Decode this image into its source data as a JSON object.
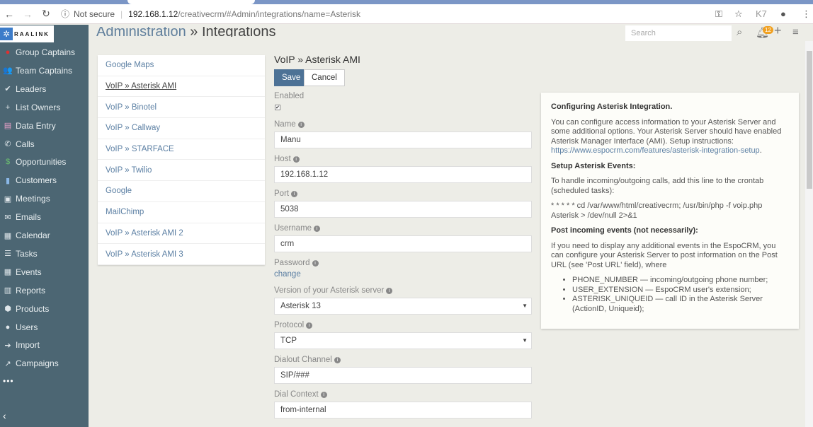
{
  "browser": {
    "not_secure": "Not secure",
    "url_host": "192.168.1.12",
    "url_path": "/creativecrm/#Admin/integrations/name=Asterisk"
  },
  "logo": "RAALINK",
  "sidebar": {
    "items": [
      {
        "label": "Group Captains",
        "icon": "●",
        "color": "#e03030"
      },
      {
        "label": "Team Captains",
        "icon": "👥",
        "color": "#dfe6ea"
      },
      {
        "label": "Leaders",
        "icon": "✔",
        "color": "#dfe6ea"
      },
      {
        "label": "List Owners",
        "icon": "+",
        "color": "#dfe6ea"
      },
      {
        "label": "Data Entry",
        "icon": "▤",
        "color": "#e8a0c8"
      },
      {
        "label": "Calls",
        "icon": "✆",
        "color": "#dfe6ea"
      },
      {
        "label": "Opportunities",
        "icon": "$",
        "color": "#6cc070"
      },
      {
        "label": "Customers",
        "icon": "▮",
        "color": "#8ab8e8"
      },
      {
        "label": "Meetings",
        "icon": "▣",
        "color": "#dfe6ea"
      },
      {
        "label": "Emails",
        "icon": "✉",
        "color": "#dfe6ea"
      },
      {
        "label": "Calendar",
        "icon": "▦",
        "color": "#dfe6ea"
      },
      {
        "label": "Tasks",
        "icon": "☰",
        "color": "#dfe6ea"
      },
      {
        "label": "Events",
        "icon": "▦",
        "color": "#dfe6ea"
      },
      {
        "label": "Reports",
        "icon": "▥",
        "color": "#dfe6ea"
      },
      {
        "label": "Products",
        "icon": "⬢",
        "color": "#dfe6ea"
      },
      {
        "label": "Users",
        "icon": "●",
        "color": "#dfe6ea"
      },
      {
        "label": "Import",
        "icon": "➔",
        "color": "#dfe6ea"
      },
      {
        "label": "Campaigns",
        "icon": "↗",
        "color": "#dfe6ea"
      }
    ],
    "more": "•••",
    "collapse": "‹"
  },
  "header": {
    "breadcrumb_link": "Administration",
    "breadcrumb_sep": " » ",
    "breadcrumb_current": "Integrations",
    "search_placeholder": "Search",
    "notification_count": "12"
  },
  "integrations": [
    "Google Maps",
    "VoIP » Asterisk AMI",
    "VoIP » Binotel",
    "VoIP » Callway",
    "VoIP » STARFACE",
    "VoIP » Twilio",
    "Google",
    "MailChimp",
    "VoIP » Asterisk AMI 2",
    "VoIP » Asterisk AMI 3"
  ],
  "form": {
    "title": "VoIP » Asterisk AMI",
    "save": "Save",
    "cancel": "Cancel",
    "enabled_label": "Enabled",
    "enabled_check": "✔",
    "fields": {
      "name": {
        "label": "Name",
        "value": "Manu"
      },
      "host": {
        "label": "Host",
        "value": "192.168.1.12"
      },
      "port": {
        "label": "Port",
        "value": "5038"
      },
      "username": {
        "label": "Username",
        "value": "crm"
      },
      "password": {
        "label": "Password",
        "link": "change"
      },
      "version": {
        "label": "Version of your Asterisk server",
        "value": "Asterisk 13"
      },
      "protocol": {
        "label": "Protocol",
        "value": "TCP"
      },
      "dialout": {
        "label": "Dialout Channel",
        "value": "SIP/###"
      },
      "context": {
        "label": "Dial Context",
        "value": "from-internal"
      }
    }
  },
  "help": {
    "h1": "Configuring Asterisk Integration.",
    "p1": "You can configure access information to your Asterisk Server and some additional options. Your Asterisk Server should have enabled Asterisk Manager Interface (AMI). Setup instructions: ",
    "p1_link": "https://www.espocrm.com/features/asterisk-integration-setup",
    "h2": "Setup Asterisk Events:",
    "p2": "To handle incoming/outgoing calls, add this line to the crontab (scheduled tasks):",
    "p3": "* * * * * cd /var/www/html/creativecrm; /usr/bin/php -f voip.php Asterisk > /dev/null 2>&1",
    "h3": "Post incoming events (not necessarily):",
    "p4": "If you need to display any additional events in the EspoCRM, you can configure your Asterisk Server to post information on the Post URL (see 'Post URL' field), where",
    "bullets": [
      "PHONE_NUMBER — incoming/outgoing phone number;",
      "USER_EXTENSION — EspoCRM user's extension;",
      "ASTERISK_UNIQUEID — call ID in the Asterisk Server (ActionID, Uniqueid);"
    ]
  }
}
